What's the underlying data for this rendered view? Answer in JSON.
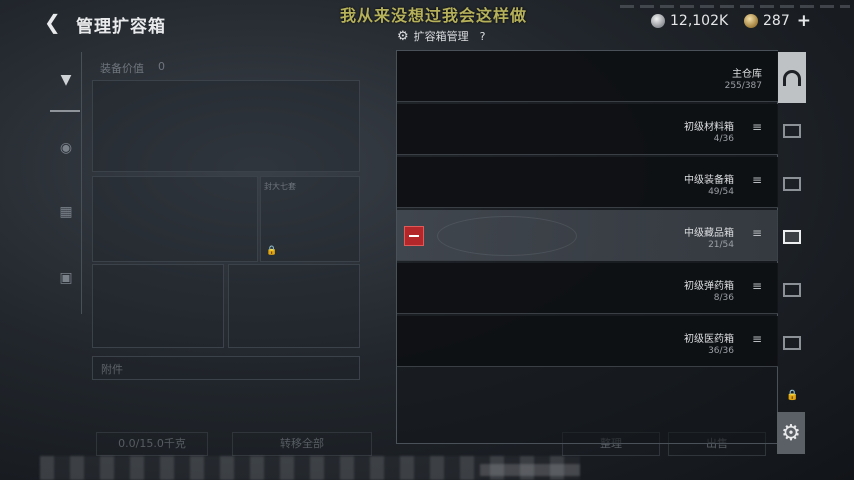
{
  "header": {
    "title": "管理扩容箱",
    "caption": "我从来没想过我会这样做"
  },
  "currency": {
    "silver": "12,102K",
    "gold": "287"
  },
  "left_panel": {
    "equip_label": "装备价值",
    "equip_value": "0",
    "storage_slot_label": "封大七套",
    "extra_label": "附件",
    "buttons": [
      "0.0/15.0千克",
      "转移全部",
      "整理",
      "出售"
    ]
  },
  "box_panel": {
    "header_title": "扩容箱管理",
    "rows": [
      {
        "name": "主仓库",
        "count": "255/387",
        "icon": "warehouse-icon"
      },
      {
        "name": "初级材料箱",
        "count": "4/36",
        "icon": "material-box-icon"
      },
      {
        "name": "中级装备箱",
        "count": "49/54",
        "icon": "equipment-box-icon"
      },
      {
        "name": "中级藏品箱",
        "count": "21/54",
        "icon": "collection-box-icon"
      },
      {
        "name": "初级弹药箱",
        "count": "8/36",
        "icon": "ammo-box-icon"
      },
      {
        "name": "初级医药箱",
        "count": "36/36",
        "icon": "medical-box-icon"
      }
    ]
  },
  "colors": {
    "remove_red": "#b3262a",
    "caption_yellow": "#b5b05a",
    "selected_row": "#464c54"
  }
}
